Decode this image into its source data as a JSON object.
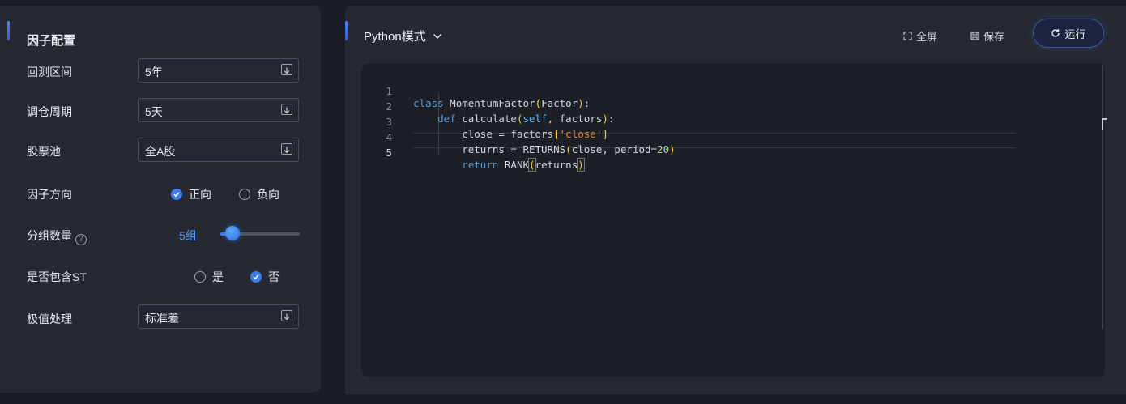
{
  "factor_config": {
    "title": "因子配置",
    "backtest_period": {
      "label": "回测区间",
      "value": "5年"
    },
    "rebalance_period": {
      "label": "调仓周期",
      "value": "5天"
    },
    "stock_pool": {
      "label": "股票池",
      "value": "全A股"
    },
    "factor_direction": {
      "label": "因子方向",
      "options": [
        "正向",
        "负向"
      ],
      "selected": "正向"
    },
    "group_count": {
      "label": "分组数量",
      "help": "?",
      "value_text": "5组",
      "value": 5,
      "fraction": 0.15
    },
    "include_st": {
      "label": "是否包含ST",
      "options": [
        "是",
        "否"
      ],
      "selected": "否"
    },
    "outlier_handling": {
      "label": "极值处理",
      "value": "标准差"
    }
  },
  "editor_panel": {
    "mode": "Python模式",
    "toolbar": {
      "fullscreen": "全屏",
      "save": "保存",
      "run": "运行"
    },
    "code": {
      "line_numbers": [
        "1",
        "2",
        "3",
        "4",
        "5"
      ],
      "l1": {
        "kw": "class",
        "rest": " MomentumFactor",
        "p1": "(",
        "arg": "Factor",
        "p2": ")",
        "end": ":"
      },
      "l2": {
        "kw": "def",
        "rest": " calculate",
        "p1": "(",
        "self": "self",
        "args": ", factors",
        "p2": ")",
        "end": ":"
      },
      "l3": {
        "pre": "close = factors",
        "b1": "[",
        "str": "'close'",
        "b2": "]"
      },
      "l4": {
        "pre": "returns = RETURNS",
        "p1": "(",
        "mid": "close, period=",
        "num": "20",
        "p2": ")"
      },
      "l5": {
        "kw": "return",
        "rest": " RANK",
        "p1": "(",
        "arg": "returns",
        "p2": ")"
      }
    },
    "colors": {
      "keyword": "#569cd6",
      "string": "#e0893e",
      "number": "#b5cea8",
      "bracket": "#ffd700",
      "accent": "#3d7cf5"
    }
  }
}
